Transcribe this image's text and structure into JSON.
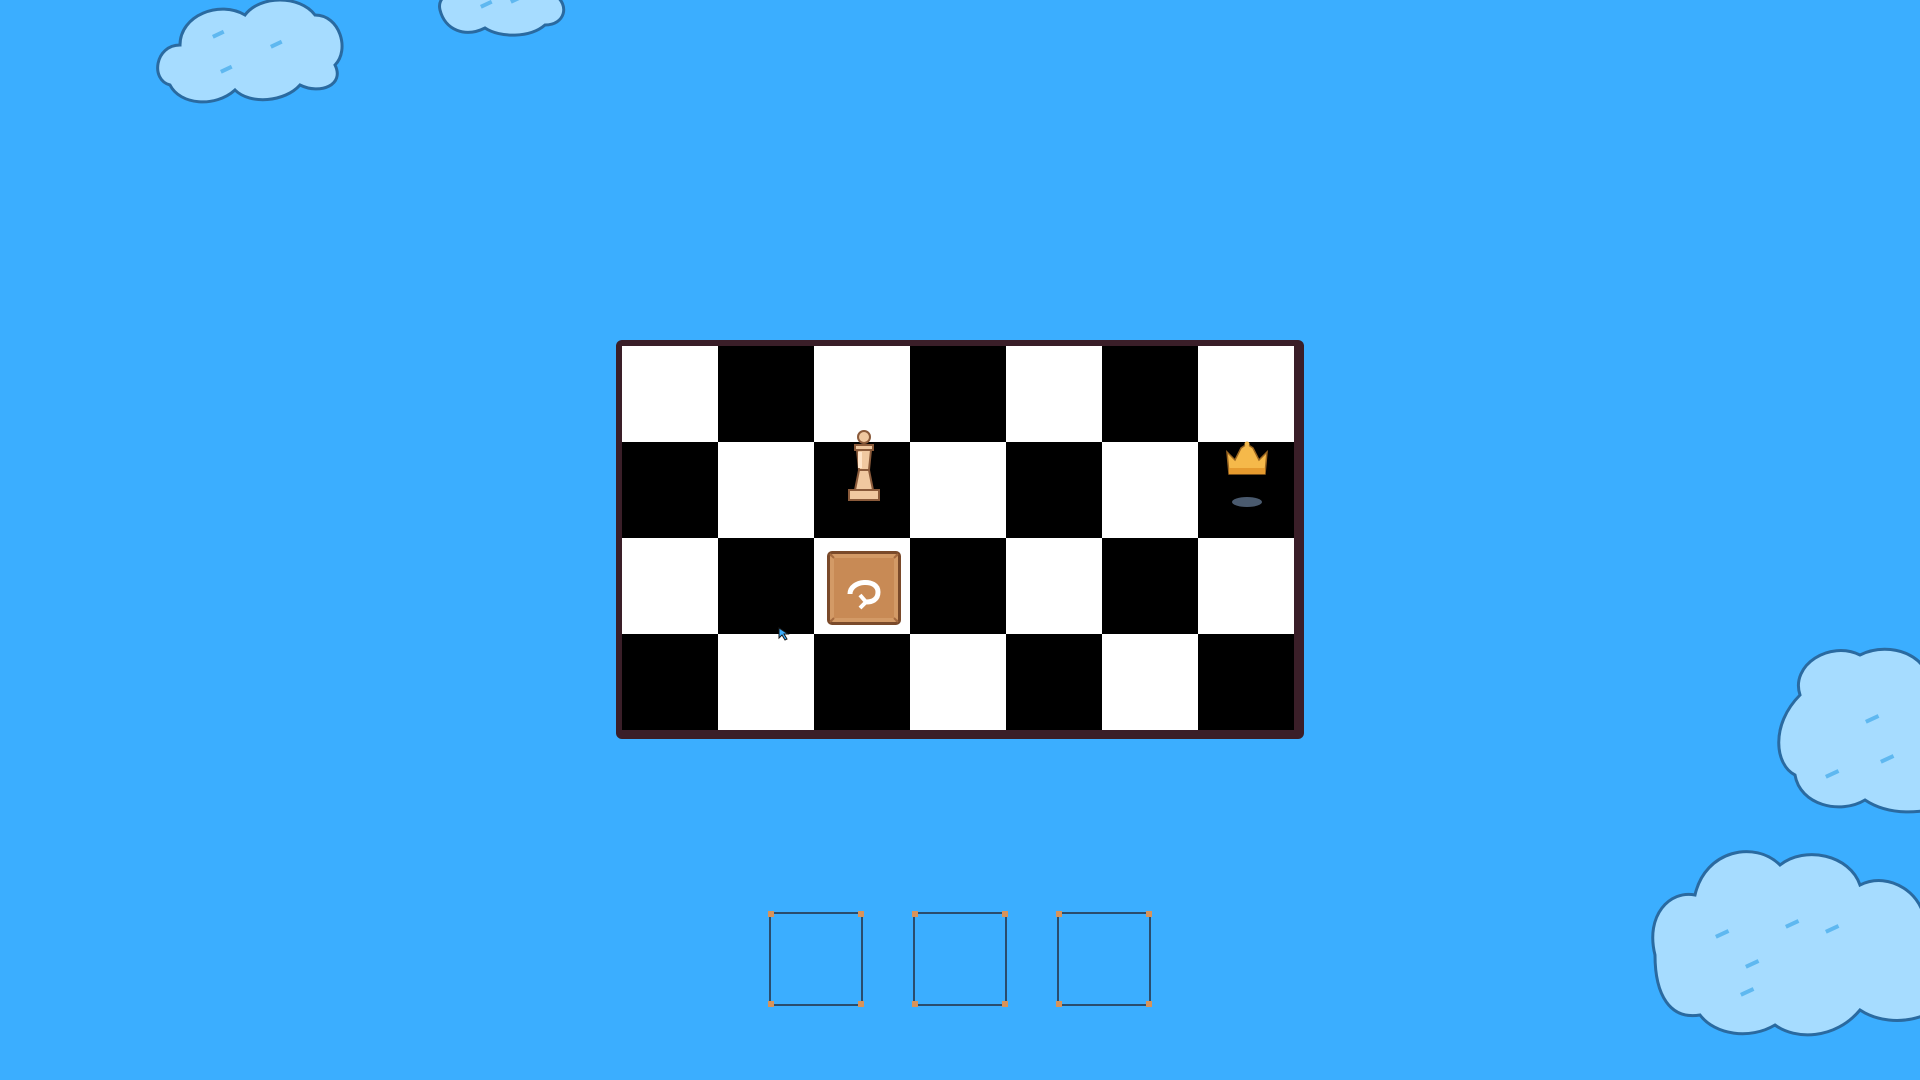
{
  "scene": {
    "background_color": "#3baeff",
    "board": {
      "columns": 7,
      "rows": 4,
      "light_color": "#ffffff",
      "dark_color": "#000000",
      "frame_color": "#3a1e28"
    },
    "pieces": [
      {
        "kind": "pawn",
        "color": "#f0c8a0",
        "square": "c3"
      },
      {
        "kind": "crown-goal",
        "color": "#f5b94a",
        "square": "g3"
      }
    ],
    "action_tile": {
      "icon": "undo-arrow-icon",
      "color": "#d39a66",
      "square": "c2"
    },
    "inventory_slots": [
      {
        "empty": true
      },
      {
        "empty": true
      },
      {
        "empty": true
      }
    ],
    "slot_corner_color": "#d8935a",
    "cloud_color": "#a6dcff"
  }
}
